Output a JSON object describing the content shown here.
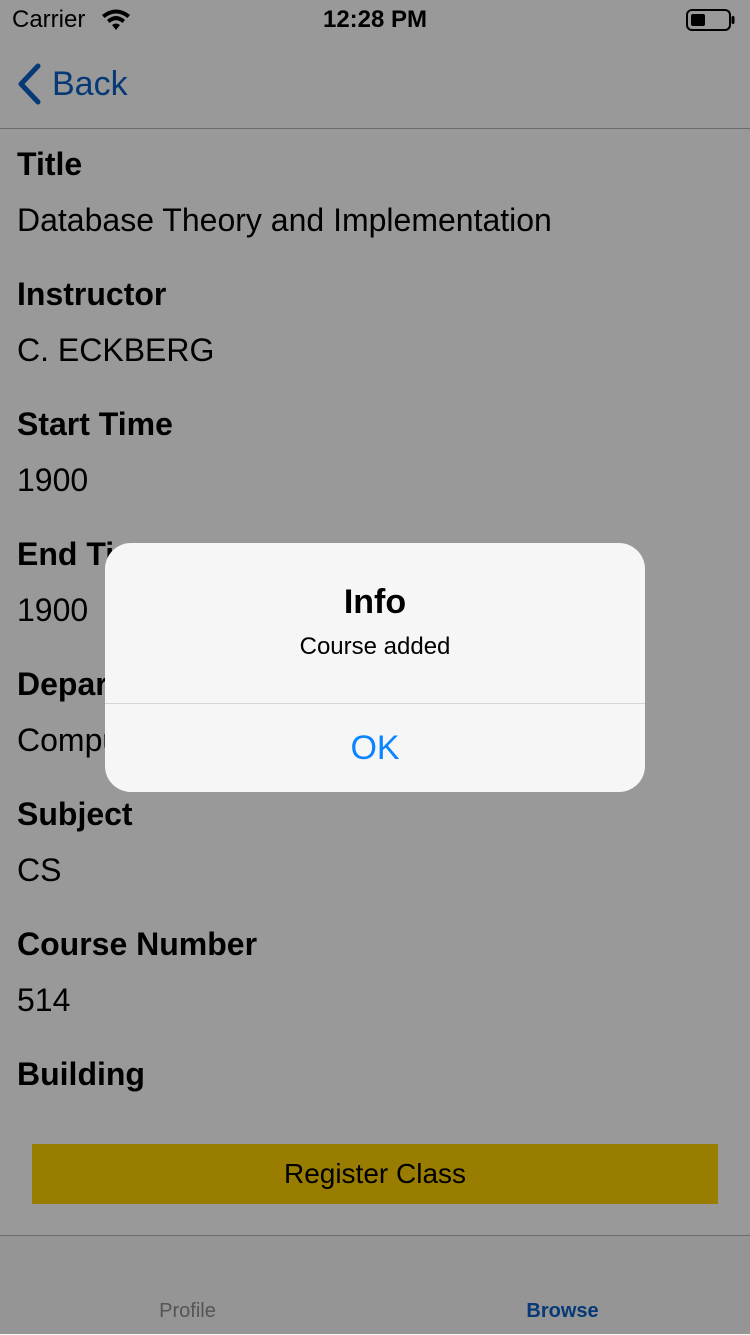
{
  "status_bar": {
    "carrier": "Carrier",
    "time": "12:28 PM"
  },
  "nav": {
    "back_label": "Back"
  },
  "fields": [
    {
      "label": "Title",
      "value": "Database Theory and Implementation"
    },
    {
      "label": "Instructor",
      "value": "C. ECKBERG"
    },
    {
      "label": "Start Time",
      "value": "1900"
    },
    {
      "label": "End Time",
      "value": "1900"
    },
    {
      "label": "Department",
      "value": "Computer Science"
    },
    {
      "label": "Subject",
      "value": "CS"
    },
    {
      "label": "Course Number",
      "value": "514"
    },
    {
      "label": "Building",
      "value": ""
    }
  ],
  "register_button": "Register Class",
  "tabs": [
    {
      "label": "Profile",
      "active": false
    },
    {
      "label": "Browse",
      "active": true
    }
  ],
  "alert": {
    "title": "Info",
    "message": "Course added",
    "ok_label": "OK"
  },
  "colors": {
    "accent": "#0a5fc4",
    "alert_button": "#0a84ff",
    "register_bg": "#ffd100"
  }
}
